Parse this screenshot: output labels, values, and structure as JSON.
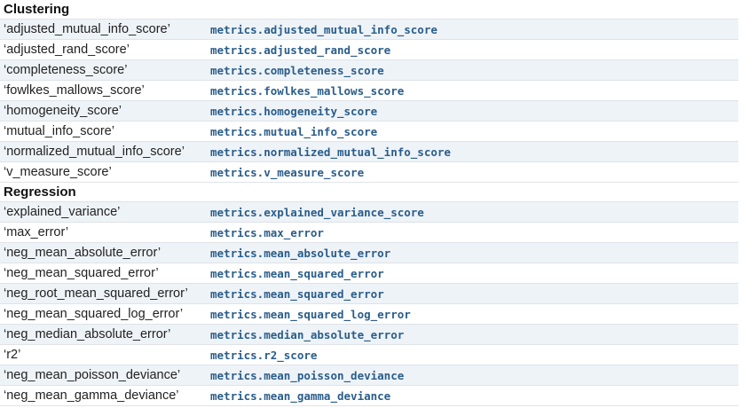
{
  "sections": [
    {
      "title": "Clustering",
      "rows": [
        {
          "name": "‘adjusted_mutual_info_score’",
          "func": "metrics.adjusted_mutual_info_score"
        },
        {
          "name": "‘adjusted_rand_score’",
          "func": "metrics.adjusted_rand_score"
        },
        {
          "name": "‘completeness_score’",
          "func": "metrics.completeness_score"
        },
        {
          "name": "‘fowlkes_mallows_score’",
          "func": "metrics.fowlkes_mallows_score"
        },
        {
          "name": "‘homogeneity_score’",
          "func": "metrics.homogeneity_score"
        },
        {
          "name": "‘mutual_info_score’",
          "func": "metrics.mutual_info_score"
        },
        {
          "name": "‘normalized_mutual_info_score’",
          "func": "metrics.normalized_mutual_info_score"
        },
        {
          "name": "‘v_measure_score’",
          "func": "metrics.v_measure_score"
        }
      ]
    },
    {
      "title": "Regression",
      "rows": [
        {
          "name": "‘explained_variance’",
          "func": "metrics.explained_variance_score"
        },
        {
          "name": "‘max_error’",
          "func": "metrics.max_error"
        },
        {
          "name": "‘neg_mean_absolute_error’",
          "func": "metrics.mean_absolute_error"
        },
        {
          "name": "‘neg_mean_squared_error’",
          "func": "metrics.mean_squared_error"
        },
        {
          "name": "‘neg_root_mean_squared_error’",
          "func": "metrics.mean_squared_error"
        },
        {
          "name": "‘neg_mean_squared_log_error’",
          "func": "metrics.mean_squared_log_error"
        },
        {
          "name": "‘neg_median_absolute_error’",
          "func": "metrics.median_absolute_error"
        },
        {
          "name": "‘r2’",
          "func": "metrics.r2_score"
        },
        {
          "name": "‘neg_mean_poisson_deviance’",
          "func": "metrics.mean_poisson_deviance"
        },
        {
          "name": "‘neg_mean_gamma_deviance’",
          "func": "metrics.mean_gamma_deviance"
        }
      ]
    }
  ],
  "colors": {
    "link": "#2a5d8a",
    "alt_row": "#eef3f8",
    "border": "#dfe3e8"
  }
}
